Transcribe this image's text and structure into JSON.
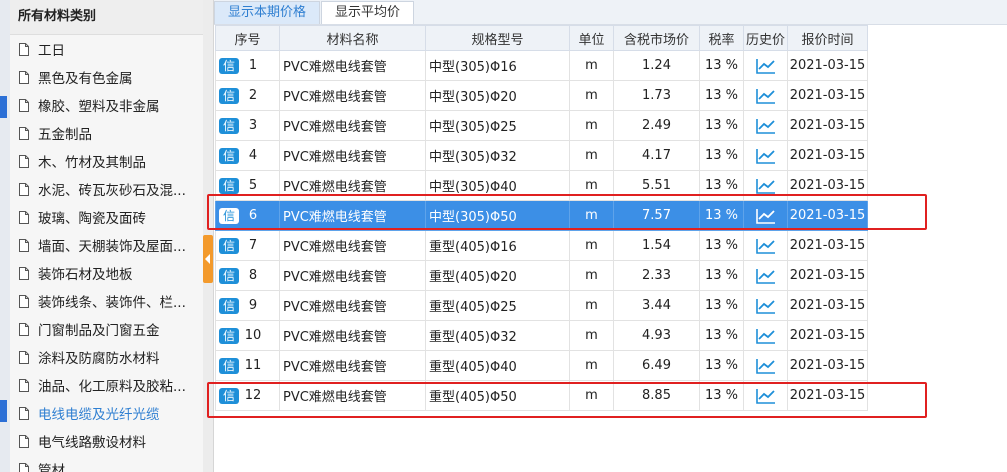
{
  "sidebar": {
    "title": "所有材料类别",
    "items": [
      {
        "label": "工日",
        "active": false
      },
      {
        "label": "黑色及有色金属",
        "active": false
      },
      {
        "label": "橡胶、塑料及非金属",
        "active": false
      },
      {
        "label": "五金制品",
        "active": false
      },
      {
        "label": "木、竹材及其制品",
        "active": false
      },
      {
        "label": "水泥、砖瓦灰砂石及混...",
        "active": false
      },
      {
        "label": "玻璃、陶瓷及面砖",
        "active": false
      },
      {
        "label": "墙面、天棚装饰及屋面...",
        "active": false
      },
      {
        "label": "装饰石材及地板",
        "active": false
      },
      {
        "label": "装饰线条、装饰件、栏...",
        "active": false
      },
      {
        "label": "门窗制品及门窗五金",
        "active": false
      },
      {
        "label": "涂料及防腐防水材料",
        "active": false
      },
      {
        "label": "油品、化工原料及胶粘...",
        "active": false
      },
      {
        "label": "电线电缆及光纤光缆",
        "active": true
      },
      {
        "label": "电气线路敷设材料",
        "active": false
      },
      {
        "label": "管材",
        "active": false
      }
    ]
  },
  "tabs": [
    {
      "label": "显示本期价格",
      "active": true
    },
    {
      "label": "显示平均价",
      "active": false
    }
  ],
  "table": {
    "columns": [
      "序号",
      "材料名称",
      "规格型号",
      "单位",
      "含税市场价",
      "税率",
      "历史价",
      "报价时间"
    ],
    "badge": "信",
    "rows": [
      {
        "seq": "1",
        "name": "PVC难燃电线套管",
        "spec": "中型(305)Φ16",
        "unit": "m",
        "price": "1.24",
        "tax": "13 %",
        "date": "2021-03-15",
        "selected": false
      },
      {
        "seq": "2",
        "name": "PVC难燃电线套管",
        "spec": "中型(305)Φ20",
        "unit": "m",
        "price": "1.73",
        "tax": "13 %",
        "date": "2021-03-15",
        "selected": false
      },
      {
        "seq": "3",
        "name": "PVC难燃电线套管",
        "spec": "中型(305)Φ25",
        "unit": "m",
        "price": "2.49",
        "tax": "13 %",
        "date": "2021-03-15",
        "selected": false
      },
      {
        "seq": "4",
        "name": "PVC难燃电线套管",
        "spec": "中型(305)Φ32",
        "unit": "m",
        "price": "4.17",
        "tax": "13 %",
        "date": "2021-03-15",
        "selected": false
      },
      {
        "seq": "5",
        "name": "PVC难燃电线套管",
        "spec": "中型(305)Φ40",
        "unit": "m",
        "price": "5.51",
        "tax": "13 %",
        "date": "2021-03-15",
        "selected": false
      },
      {
        "seq": "6",
        "name": "PVC难燃电线套管",
        "spec": "中型(305)Φ50",
        "unit": "m",
        "price": "7.57",
        "tax": "13 %",
        "date": "2021-03-15",
        "selected": true
      },
      {
        "seq": "7",
        "name": "PVC难燃电线套管",
        "spec": "重型(405)Φ16",
        "unit": "m",
        "price": "1.54",
        "tax": "13 %",
        "date": "2021-03-15",
        "selected": false
      },
      {
        "seq": "8",
        "name": "PVC难燃电线套管",
        "spec": "重型(405)Φ20",
        "unit": "m",
        "price": "2.33",
        "tax": "13 %",
        "date": "2021-03-15",
        "selected": false
      },
      {
        "seq": "9",
        "name": "PVC难燃电线套管",
        "spec": "重型(405)Φ25",
        "unit": "m",
        "price": "3.44",
        "tax": "13 %",
        "date": "2021-03-15",
        "selected": false
      },
      {
        "seq": "10",
        "name": "PVC难燃电线套管",
        "spec": "重型(405)Φ32",
        "unit": "m",
        "price": "4.93",
        "tax": "13 %",
        "date": "2021-03-15",
        "selected": false
      },
      {
        "seq": "11",
        "name": "PVC难燃电线套管",
        "spec": "重型(405)Φ40",
        "unit": "m",
        "price": "6.49",
        "tax": "13 %",
        "date": "2021-03-15",
        "selected": false
      },
      {
        "seq": "12",
        "name": "PVC难燃电线套管",
        "spec": "重型(405)Φ50",
        "unit": "m",
        "price": "8.85",
        "tax": "13 %",
        "date": "2021-03-15",
        "selected": false
      }
    ]
  },
  "colors": {
    "accent": "#2f7fd1",
    "selected_row": "#3c8fe6",
    "badge": "#1e8fd8",
    "highlight_box": "#e02020",
    "collapse_tab": "#f39a2c"
  },
  "icons": {
    "document": "document-icon",
    "trend": "trend-chart-icon",
    "collapse": "collapse-arrow-icon"
  }
}
